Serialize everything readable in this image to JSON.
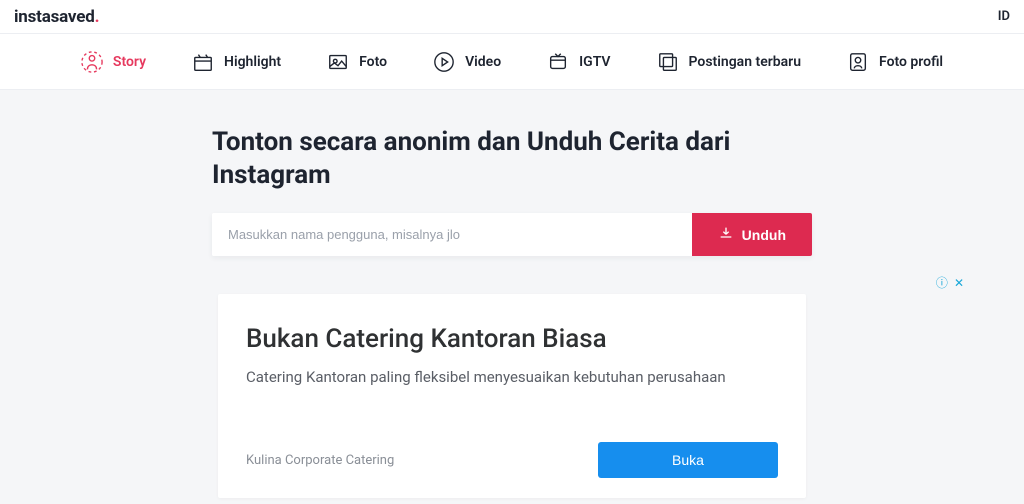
{
  "header": {
    "logo_text": "instasaved",
    "logo_dot": ".",
    "lang": "ID"
  },
  "nav": {
    "items": [
      {
        "label": "Story",
        "icon": "story-icon",
        "active": true
      },
      {
        "label": "Highlight",
        "icon": "highlight-icon",
        "active": false
      },
      {
        "label": "Foto",
        "icon": "photo-icon",
        "active": false
      },
      {
        "label": "Video",
        "icon": "video-icon",
        "active": false
      },
      {
        "label": "IGTV",
        "icon": "igtv-icon",
        "active": false
      },
      {
        "label": "Postingan terbaru",
        "icon": "recent-icon",
        "active": false
      },
      {
        "label": "Foto profil",
        "icon": "profile-icon",
        "active": false
      }
    ]
  },
  "hero": {
    "title": "Tonton secara anonim dan Unduh Cerita dari Instagram",
    "placeholder": "Masukkan nama pengguna, misalnya jlo",
    "button": "Unduh"
  },
  "ad": {
    "title": "Bukan Catering Kantoran Biasa",
    "subtitle": "Catering Kantoran paling fleksibel menyesuaikan kebutuhan perusahaan",
    "brand": "Kulina Corporate Catering",
    "cta": "Buka"
  }
}
